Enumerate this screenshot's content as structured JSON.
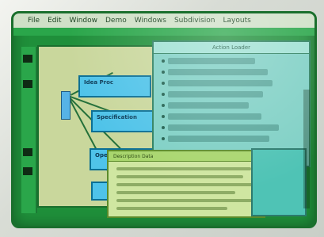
{
  "menubar": {
    "items": [
      "File",
      "Edit",
      "Window",
      "Demo",
      "Windows",
      "Subdivision",
      "Layouts"
    ]
  },
  "diagram": {
    "boxes": [
      {
        "label": "Idea Proc"
      },
      {
        "label": "Specification"
      },
      {
        "label": "Operat"
      },
      {
        "label": ""
      }
    ]
  },
  "list_panel": {
    "title": "Action Loader"
  },
  "note_panel": {
    "header": "Description Data"
  },
  "colors": {
    "screen_green": "#1f8f3a",
    "menubar_bg": "#cfe0c7",
    "box_blue": "#4fc3e9",
    "panel_yellow": "#cfe6a1",
    "list_teal": "#7fd0c5"
  }
}
